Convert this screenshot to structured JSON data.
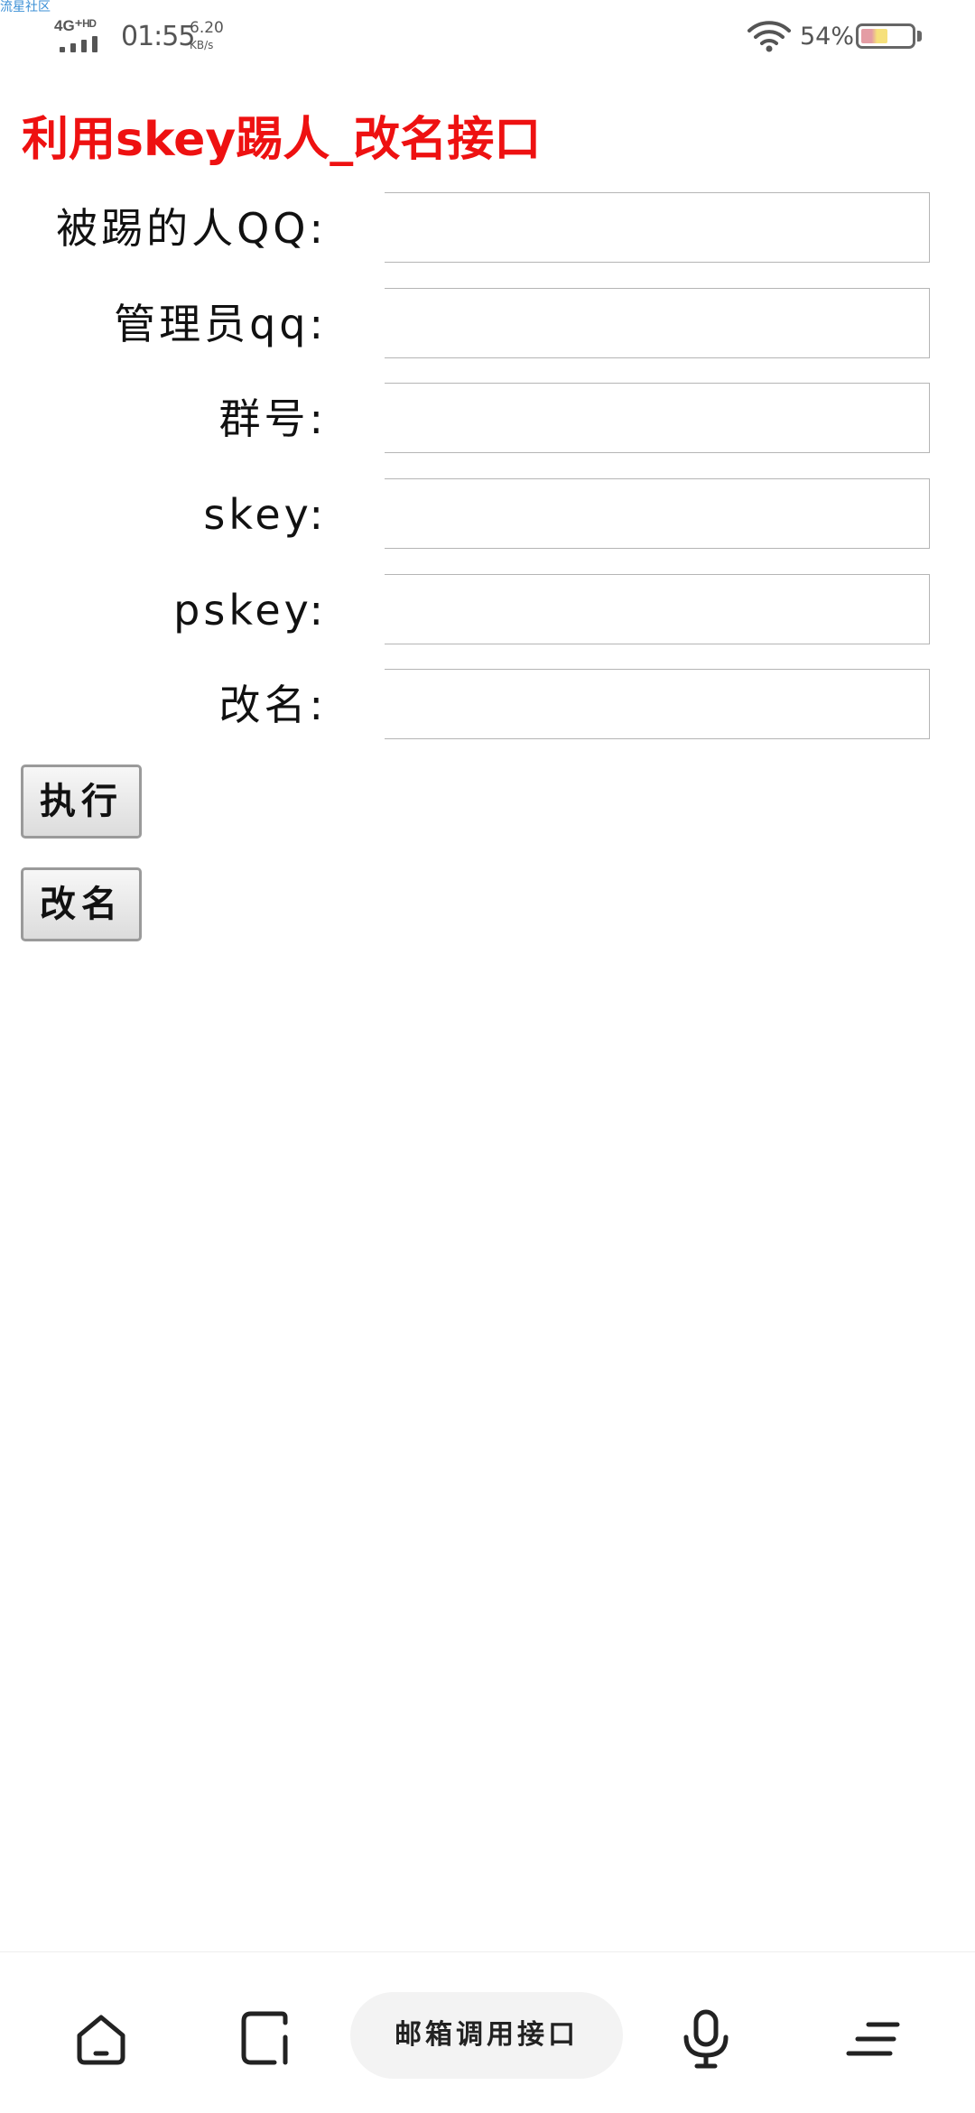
{
  "watermark": "流星社区",
  "status_bar": {
    "network": "4G⁺ᴴᴰ",
    "time": "01:55",
    "speed_value": "6.20",
    "speed_unit": "KB/s",
    "battery_text": "54%",
    "battery_level": 0.54
  },
  "page": {
    "title": "利用skey踢人_改名接口"
  },
  "form": {
    "fields": [
      {
        "label": "被踢的人QQ:",
        "value": ""
      },
      {
        "label": "管理员qq:",
        "value": ""
      },
      {
        "label": "群号:",
        "value": ""
      },
      {
        "label": "skey:",
        "value": ""
      },
      {
        "label": "pskey:",
        "value": ""
      },
      {
        "label": "改名:",
        "value": ""
      }
    ],
    "buttons": {
      "execute": "执行",
      "rename": "改名"
    }
  },
  "bottom_nav": {
    "center_label": "邮箱调用接口",
    "icons": [
      "home-icon",
      "tabs-icon",
      "microphone-icon",
      "menu-icon"
    ]
  }
}
